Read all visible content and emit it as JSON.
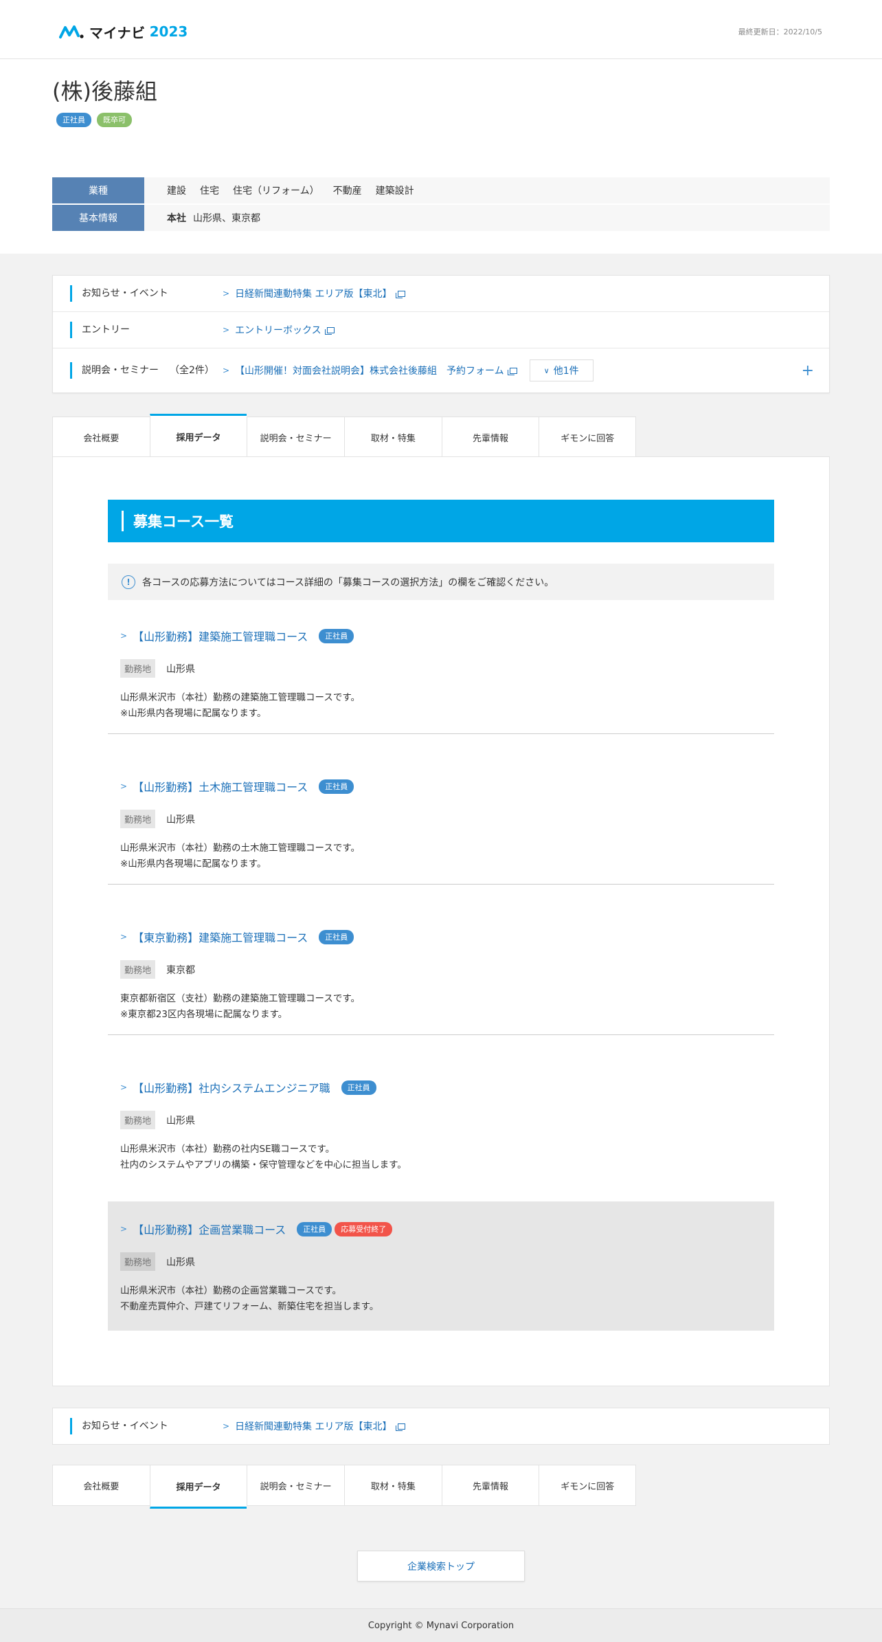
{
  "header": {
    "logo_word": "マイナビ",
    "logo_year": "2023",
    "last_updated": "最終更新日：2022/10/5"
  },
  "company": {
    "name": "(株)後藤組",
    "tags": [
      "正社員",
      "既卒可"
    ],
    "info": [
      {
        "label": "業種",
        "industries": [
          "建設",
          "住宅",
          "住宅（リフォーム）",
          "不動産",
          "建築設計"
        ]
      },
      {
        "label": "基本情報",
        "key": "本社",
        "value": "山形県、東京都"
      }
    ]
  },
  "notices": [
    {
      "label": "お知らせ・イベント",
      "link": "日経新聞連動特集 エリア版【東北】"
    },
    {
      "label": "エントリー",
      "link": "エントリーボックス"
    },
    {
      "label": "説明会・セミナー",
      "count": "（全2件）",
      "link": "【山形開催！対面会社説明会】株式会社後藤組　予約フォーム",
      "more": "他1件",
      "expand": "+"
    }
  ],
  "tabs": [
    "会社概要",
    "採用データ",
    "説明会・セミナー",
    "取材・特集",
    "先輩情報",
    "ギモンに回答"
  ],
  "active_tab": "採用データ",
  "courses_section": {
    "title": "募集コース一覧",
    "note": "各コースの応募方法についてはコース詳細の「募集コースの選択方法」の欄をご確認ください。",
    "location_label": "勤務地",
    "courses": [
      {
        "title": "【山形勤務】建築施工管理職コース",
        "badges": [
          "正社員"
        ],
        "location": "山形県",
        "desc1": "山形県米沢市（本社）勤務の建築施工管理職コースです。",
        "desc2": "※山形県内各現場に配属なります。"
      },
      {
        "title": "【山形勤務】土木施工管理職コース",
        "badges": [
          "正社員"
        ],
        "location": "山形県",
        "desc1": "山形県米沢市（本社）勤務の土木施工管理職コースです。",
        "desc2": "※山形県内各現場に配属なります。"
      },
      {
        "title": "【東京勤務】建築施工管理職コース",
        "badges": [
          "正社員"
        ],
        "location": "東京都",
        "desc1": "東京都新宿区（支社）勤務の建築施工管理職コースです。",
        "desc2": "※東京都23区内各現場に配属なります。"
      },
      {
        "title": "【山形勤務】社内システムエンジニア職",
        "badges": [
          "正社員"
        ],
        "location": "山形県",
        "desc1": "山形県米沢市（本社）勤務の社内SE職コースです。",
        "desc2": "社内のシステムやアプリの構築・保守管理などを中心に担当します。"
      },
      {
        "title": "【山形勤務】企画営業職コース",
        "badges": [
          "正社員",
          "応募受付終了"
        ],
        "location": "山形県",
        "desc1": "山形県米沢市（本社）勤務の企画営業職コースです。",
        "desc2": "不動産売買仲介、戸建てリフォーム、新築住宅を担当します。"
      }
    ]
  },
  "bottom_notice": {
    "label": "お知らせ・イベント",
    "link": "日経新聞連動特集 エリア版【東北】"
  },
  "search_top": "企業検索トップ",
  "footer": "Copyright © Mynavi Corporation"
}
